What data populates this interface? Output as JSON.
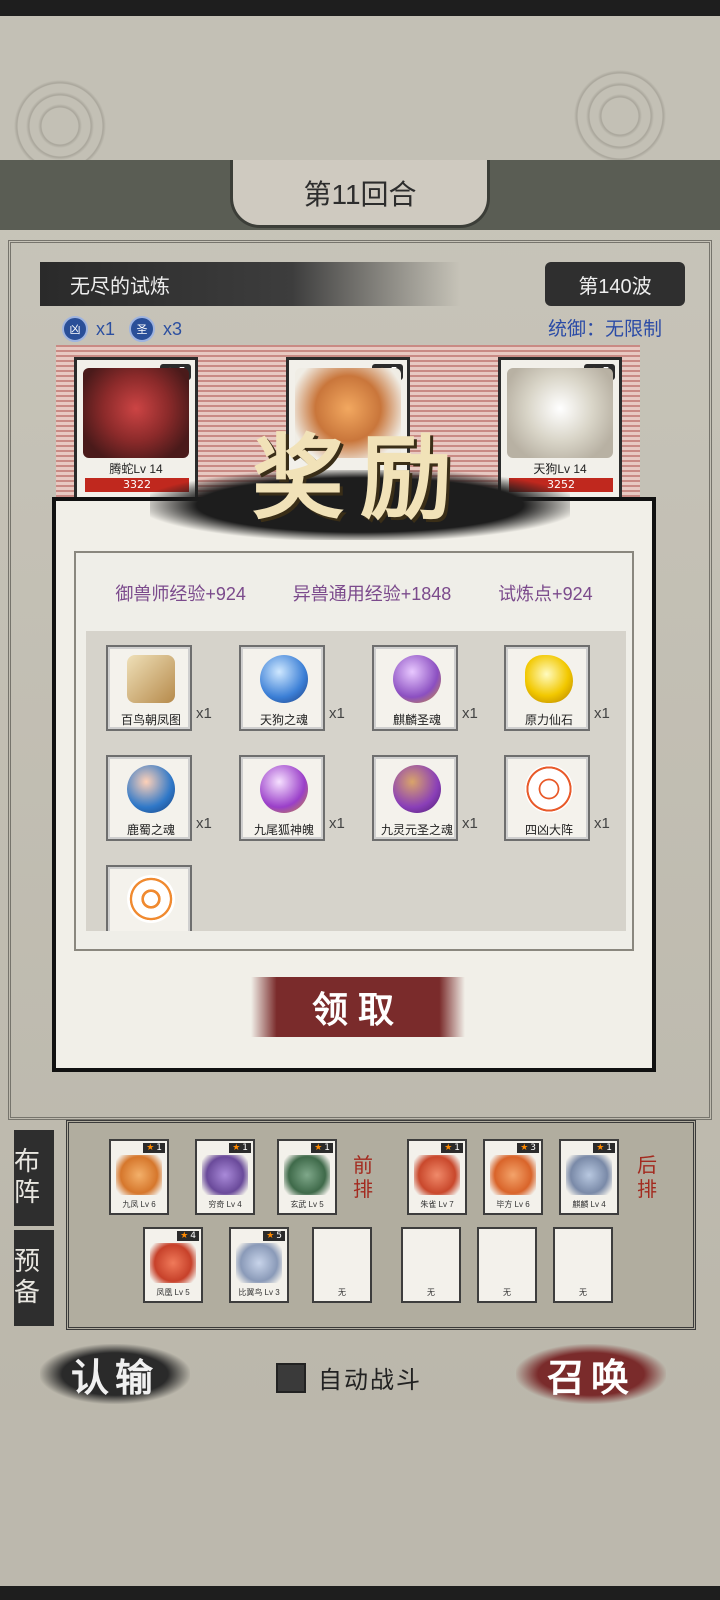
{
  "round": {
    "label": "第11回合"
  },
  "trial": {
    "name": "无尽的试炼",
    "wave": "第140波"
  },
  "counters": [
    {
      "badge": "凶",
      "count": "x1"
    },
    {
      "badge": "圣",
      "count": "x3"
    }
  ],
  "control": "统御：无限制",
  "enemies": [
    {
      "stars": "5",
      "name": "腾蛇Lv 14",
      "hp": "3322",
      "color": "#8b2a2a"
    },
    {
      "stars": "5",
      "name": "",
      "hp": "",
      "color": "#c9763b"
    },
    {
      "stars": "5",
      "name": "天狗Lv 14",
      "hp": "3252",
      "color": "#d9d5c8"
    }
  ],
  "reward": {
    "title": "奖励",
    "exp": [
      "御兽师经验+924",
      "异兽通用经验+1848",
      "试炼点+924"
    ],
    "items": [
      {
        "name": "百鸟朝凤图",
        "qty": "x1",
        "color": "#d9c39a"
      },
      {
        "name": "天狗之魂",
        "qty": "x1",
        "color": "#3b7fd6"
      },
      {
        "name": "麒麟圣魂",
        "qty": "x1",
        "color": "#8b4fc1"
      },
      {
        "name": "原力仙石",
        "qty": "x1",
        "color": "#f2c800"
      },
      {
        "name": "鹿蜀之魂",
        "qty": "x1",
        "color": "#2f78c8"
      },
      {
        "name": "九尾狐神魄",
        "qty": "x1",
        "color": "#9a3fc9"
      },
      {
        "name": "九灵元圣之魂",
        "qty": "x1",
        "color": "#8a3fb8"
      },
      {
        "name": "四凶大阵",
        "qty": "x1",
        "color": "#e85a2a"
      },
      {
        "name": "",
        "qty": "",
        "color": "#f08a30"
      }
    ],
    "claim": "领取"
  },
  "lineup": {
    "tab_formation": "布阵",
    "tab_reserve": "预备",
    "front_label": "前排",
    "back_label": "后排",
    "front": [
      {
        "stars": "1",
        "name": "九凤 Lv 6",
        "color": "#d6772c"
      },
      {
        "stars": "1",
        "name": "穷奇 Lv 4",
        "color": "#6a4a9a"
      },
      {
        "stars": "1",
        "name": "玄武 Lv 5",
        "color": "#3f6a4a"
      }
    ],
    "back": [
      {
        "stars": "1",
        "name": "朱雀 Lv 7",
        "color": "#c9482c"
      },
      {
        "stars": "3",
        "name": "毕方 Lv 6",
        "color": "#d9642a"
      },
      {
        "stars": "1",
        "name": "麒麟 Lv 4",
        "color": "#7a8aa8"
      }
    ],
    "reserve": [
      {
        "stars": "4",
        "name": "凤凰 Lv 5",
        "color": "#c7412a"
      },
      {
        "stars": "5",
        "name": "比翼鸟 Lv 3",
        "color": "#8a9ab8"
      },
      {
        "stars": "",
        "name": "无",
        "color": ""
      },
      {
        "stars": "",
        "name": "无",
        "color": ""
      },
      {
        "stars": "",
        "name": "无",
        "color": ""
      },
      {
        "stars": "",
        "name": "无",
        "color": ""
      }
    ]
  },
  "buttons": {
    "surrender": "认输",
    "auto_battle": "自动战斗",
    "summon": "召唤"
  }
}
